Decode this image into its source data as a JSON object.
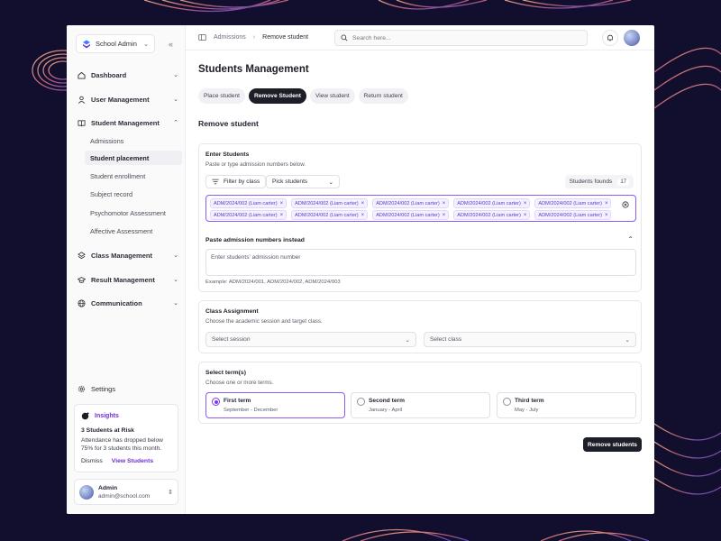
{
  "brand": {
    "name": "School Admin"
  },
  "sidebar": {
    "nav": [
      {
        "label": "Dashboard"
      },
      {
        "label": "User Management"
      },
      {
        "label": "Student Management"
      },
      {
        "label": "Class Management"
      },
      {
        "label": "Result Management"
      },
      {
        "label": "Communication"
      }
    ],
    "student_sub": [
      {
        "label": "Admissions"
      },
      {
        "label": "Student placement"
      },
      {
        "label": "Student enrollment"
      },
      {
        "label": "Subject record"
      },
      {
        "label": "Psychomotor Assessment"
      },
      {
        "label": "Affective Assessment"
      }
    ],
    "settings_label": "Settings"
  },
  "insights": {
    "label": "Insights",
    "title": "3 Students at Risk",
    "body": "Attendance has dropped below 75% for 3 students this month.",
    "dismiss": "Dismiss",
    "view": "View Students"
  },
  "user": {
    "name": "Admin",
    "email": "admin@school.com"
  },
  "topbar": {
    "crumbs": [
      "Admissions",
      "Remove student"
    ],
    "search_placeholder": "Search here..."
  },
  "page": {
    "title": "Students Management",
    "tabs": [
      "Place student",
      "Remove Student",
      "View student",
      "Return student"
    ],
    "section_title": "Remove student"
  },
  "enter_students": {
    "title": "Enter Students",
    "subtitle": "Paste or type admission numbers below.",
    "filter_label": "Filter by class",
    "pick_label": "Pick students",
    "found_label": "Students founds",
    "found_count": "17",
    "chips": [
      "ADM/2024/002 (Liam carter)",
      "ADM/2024/002 (Liam carter)",
      "ADM/2024/002 (Liam carter)",
      "ADM/2024/002 (Liam carter)",
      "ADM/2024/002 (Liam carter)",
      "ADM/2024/002 (Liam carter)",
      "ADM/2024/002 (Liam carter)",
      "ADM/2024/002 (Liam carter)",
      "ADM/2024/002 (Liam carter)",
      "ADM/2024/002 (Liam carter)"
    ],
    "paste_title": "Paste admission numbers instead",
    "paste_placeholder": "Enter students' admission number",
    "example": "Example: ADM/2024/001, ADM/2024/002, ADM/2024/003"
  },
  "class_assignment": {
    "title": "Class Assignment",
    "subtitle": "Choose the academic session and target class.",
    "session_placeholder": "Select session",
    "class_placeholder": "Select class"
  },
  "terms": {
    "title": "Select term(s)",
    "subtitle": "Choose one or more terms.",
    "items": [
      {
        "name": "First term",
        "dates": "September - December",
        "selected": true
      },
      {
        "name": "Second term",
        "dates": "January - April",
        "selected": false
      },
      {
        "name": "Third term",
        "dates": "May - July",
        "selected": false
      }
    ]
  },
  "submit_label": "Remove students",
  "colors": {
    "accent": "#7c3aed",
    "dark": "#1c1e28",
    "background": "#120f2e"
  }
}
